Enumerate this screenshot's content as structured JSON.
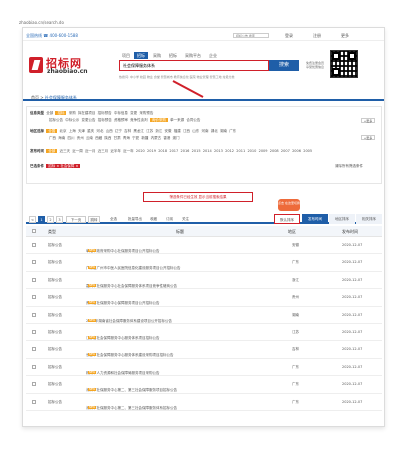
{
  "url": "zhaobiao.cn/search.do",
  "topbar": {
    "phone_label": "全国热线 ☎ 400-600-1588",
    "search_placeholder": "招标公告 搜索",
    "login": "登录",
    "register": "注册",
    "more": "更多"
  },
  "logo": {
    "cn": "招标网",
    "en": "zhaobiao.cn"
  },
  "tabs": [
    "项目",
    "招标",
    "采购",
    "招标",
    "采购平台",
    "企业"
  ],
  "active_tab_index": 1,
  "search": {
    "value": "社会保障服务体系",
    "button": "搜索"
  },
  "header_side": [
    "免费注册会员",
    "享受优惠信息"
  ],
  "hotwords": "热搜词: 中小学 校园 物业 食堂 智慧城市 教育信息化 医院 物业管理 智慧工地 垃圾分类",
  "nav": {
    "home": "首页",
    "sep": " > ",
    "current": "社会保障服务体系"
  },
  "filter": {
    "row1_key": "信息类型",
    "row1": [
      "全部",
      "招标",
      "采购",
      "拟在建项目",
      "招标预告",
      "中标信息",
      "变更",
      "采购预告"
    ],
    "row1_sub": [
      "招标公告",
      "中标公示",
      "变更公告",
      "招标预告",
      "资格预审",
      "竞争性谈判",
      "询价采购",
      "单一来源",
      "合同公告"
    ],
    "row2_key": "地区选择",
    "row2": [
      "全国",
      "北京",
      "上海",
      "天津",
      "重庆",
      "河北",
      "山西",
      "辽宁",
      "吉林",
      "黑龙江",
      "江苏",
      "浙江",
      "安徽",
      "福建",
      "江西",
      "山东",
      "河南",
      "湖北",
      "湖南",
      "广东"
    ],
    "row2_sub": [
      "广西",
      "海南",
      "四川",
      "贵州",
      "云南",
      "西藏",
      "陕西",
      "甘肃",
      "青海",
      "宁夏",
      "新疆",
      "内蒙古",
      "香港",
      "澳门"
    ],
    "row3_key": "发布时间",
    "row3": [
      "全部",
      "近三天",
      "近一周",
      "近一月",
      "近三月",
      "近半年",
      "近一年",
      "2020",
      "2019",
      "2018",
      "2017",
      "2016",
      "2015",
      "2014",
      "2013",
      "2012",
      "2011",
      "2010",
      "2009",
      "2008",
      "2007",
      "2006",
      "2005"
    ],
    "row4_key": "已选条件",
    "row4_tag": "招标 × 社会保障 ×",
    "more": "+更多",
    "reset": "清除所有筛选条件"
  },
  "annotation": "筛选条件已经生效 显示当前搜索结果",
  "bubble": "点击 在这里切换",
  "toolbar": {
    "prev": "<",
    "pages": [
      "1",
      "2",
      "3"
    ],
    "next_text": "下一页",
    "goto": "跳转",
    "checks": [
      "全选",
      "批量导出",
      "收藏",
      "订阅",
      "关注"
    ],
    "right_tabs": [
      "默认排序",
      "发布时间",
      "地区排序",
      "相关排序"
    ]
  },
  "table": {
    "headers": [
      "类型",
      "标题",
      "地区",
      "发布时间"
    ],
    "rows": [
      {
        "type": "招标公告",
        "title": "阜阳市政府采购中心社保服务项目公开招标公告",
        "region": "安徽",
        "date": "2020-12-07"
      },
      {
        "type": "招标公告",
        "title": "广东省广州市中医人民医院信息化建设服务项目公开招标公告",
        "region": "广东",
        "date": "2020-12-07"
      },
      {
        "type": "招标公告",
        "title": "嘉兴市社保服务中心社会保障服务体系项目竞争性磋商公告",
        "region": "浙江",
        "date": "2020-12-07"
      },
      {
        "type": "招标公告",
        "title": "贵州省社保服务中心保障服务项目公开招标公告",
        "region": "贵州",
        "date": "2020-12-07"
      },
      {
        "type": "招标公告",
        "title": "2021年湖南省社会保障服务体系建设项目公开招标公告",
        "region": "湖南",
        "date": "2020-12-07"
      },
      {
        "type": "招标公告",
        "title": "江苏省社会保障服务中心服务体系项目招标公告",
        "region": "江苏",
        "date": "2020-12-07"
      },
      {
        "type": "招标公告",
        "title": "长春市社会保障服务中心服务体系建设采购项目招标公告",
        "region": "吉林",
        "date": "2020-12-07"
      },
      {
        "type": "招标公告",
        "title": "珠海市人力资源和社会保障局服务项目采购公告",
        "region": "广东",
        "date": "2020-12-07"
      },
      {
        "type": "招标公告",
        "title": "深圳市社保服务中心第二、第三社会保障服务项目招标公告",
        "region": "广东",
        "date": "2020-12-07"
      },
      {
        "type": "招标公告",
        "title": "深圳市社保服务中心第二、第三社会保障服务体系招标公告",
        "region": "广东",
        "date": "2020-12-07"
      }
    ],
    "new_tag": "NEW"
  },
  "colors": {
    "brand_red": "#d0202a",
    "brand_blue": "#1f5ea8",
    "highlight": "#f5a623"
  }
}
